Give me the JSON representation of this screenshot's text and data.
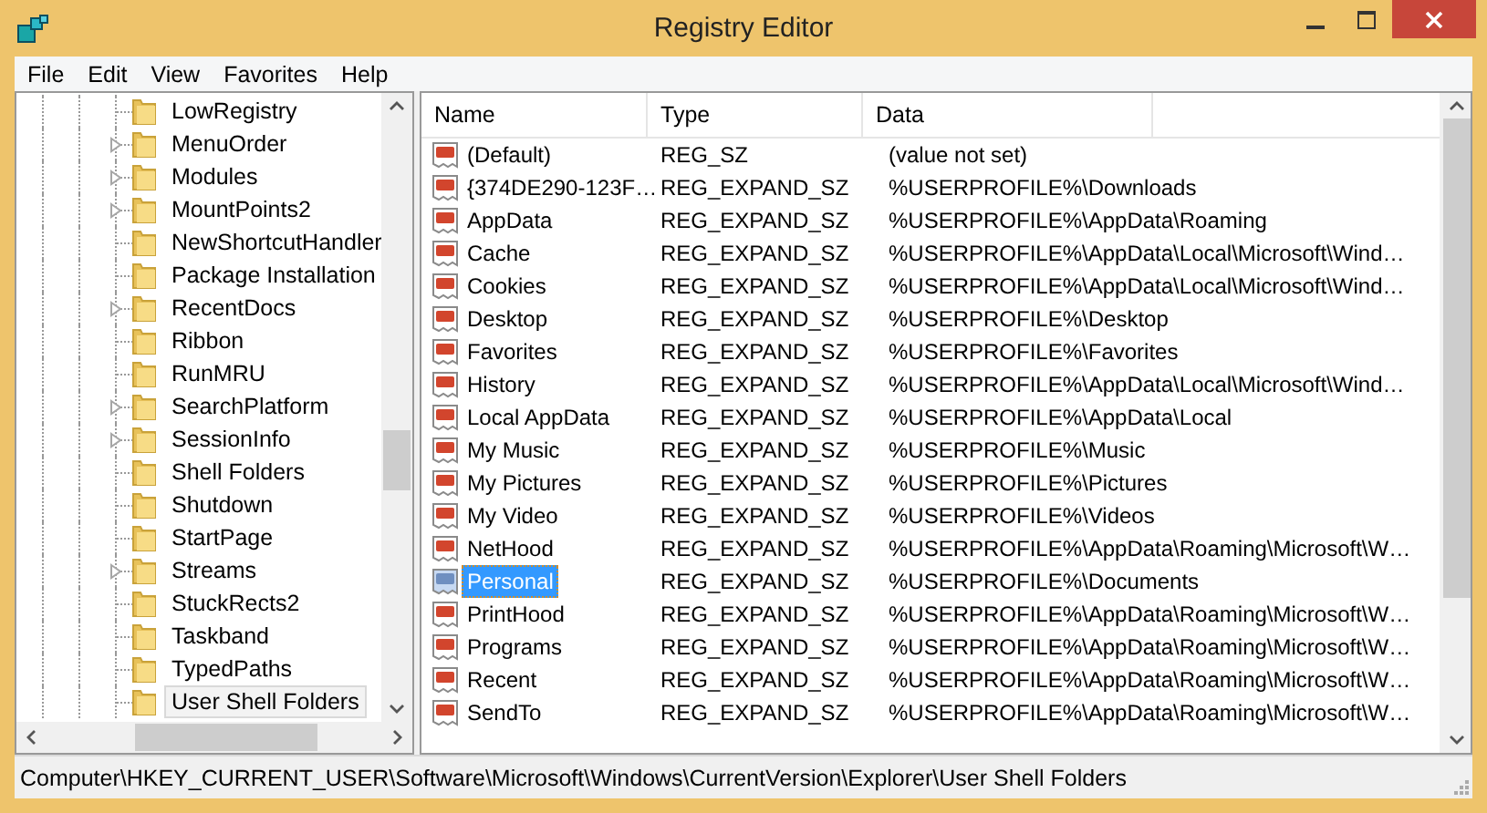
{
  "window": {
    "title": "Registry Editor"
  },
  "menu": [
    "File",
    "Edit",
    "View",
    "Favorites",
    "Help"
  ],
  "tree": {
    "items": [
      {
        "label": "LowRegistry",
        "expandable": false,
        "selected": false
      },
      {
        "label": "MenuOrder",
        "expandable": true,
        "selected": false
      },
      {
        "label": "Modules",
        "expandable": true,
        "selected": false
      },
      {
        "label": "MountPoints2",
        "expandable": true,
        "selected": false
      },
      {
        "label": "NewShortcutHandler",
        "expandable": false,
        "selected": false
      },
      {
        "label": "Package Installation",
        "expandable": false,
        "selected": false
      },
      {
        "label": "RecentDocs",
        "expandable": true,
        "selected": false
      },
      {
        "label": "Ribbon",
        "expandable": false,
        "selected": false
      },
      {
        "label": "RunMRU",
        "expandable": false,
        "selected": false
      },
      {
        "label": "SearchPlatform",
        "expandable": true,
        "selected": false
      },
      {
        "label": "SessionInfo",
        "expandable": true,
        "selected": false
      },
      {
        "label": "Shell Folders",
        "expandable": false,
        "selected": false
      },
      {
        "label": "Shutdown",
        "expandable": false,
        "selected": false
      },
      {
        "label": "StartPage",
        "expandable": false,
        "selected": false
      },
      {
        "label": "Streams",
        "expandable": true,
        "selected": false
      },
      {
        "label": "StuckRects2",
        "expandable": false,
        "selected": false
      },
      {
        "label": "Taskband",
        "expandable": false,
        "selected": false
      },
      {
        "label": "TypedPaths",
        "expandable": false,
        "selected": false
      },
      {
        "label": "User Shell Folders",
        "expandable": false,
        "selected": true
      }
    ]
  },
  "table": {
    "columns": [
      "Name",
      "Type",
      "Data"
    ],
    "rows": [
      {
        "name": "(Default)",
        "type": "REG_SZ",
        "data": "(value not set)",
        "selected": false
      },
      {
        "name": "{374DE290-123F…",
        "type": "REG_EXPAND_SZ",
        "data": "%USERPROFILE%\\Downloads",
        "selected": false
      },
      {
        "name": "AppData",
        "type": "REG_EXPAND_SZ",
        "data": "%USERPROFILE%\\AppData\\Roaming",
        "selected": false
      },
      {
        "name": "Cache",
        "type": "REG_EXPAND_SZ",
        "data": "%USERPROFILE%\\AppData\\Local\\Microsoft\\Wind…",
        "selected": false
      },
      {
        "name": "Cookies",
        "type": "REG_EXPAND_SZ",
        "data": "%USERPROFILE%\\AppData\\Local\\Microsoft\\Wind…",
        "selected": false
      },
      {
        "name": "Desktop",
        "type": "REG_EXPAND_SZ",
        "data": "%USERPROFILE%\\Desktop",
        "selected": false
      },
      {
        "name": "Favorites",
        "type": "REG_EXPAND_SZ",
        "data": "%USERPROFILE%\\Favorites",
        "selected": false
      },
      {
        "name": "History",
        "type": "REG_EXPAND_SZ",
        "data": "%USERPROFILE%\\AppData\\Local\\Microsoft\\Wind…",
        "selected": false
      },
      {
        "name": "Local AppData",
        "type": "REG_EXPAND_SZ",
        "data": "%USERPROFILE%\\AppData\\Local",
        "selected": false
      },
      {
        "name": "My Music",
        "type": "REG_EXPAND_SZ",
        "data": "%USERPROFILE%\\Music",
        "selected": false
      },
      {
        "name": "My Pictures",
        "type": "REG_EXPAND_SZ",
        "data": "%USERPROFILE%\\Pictures",
        "selected": false
      },
      {
        "name": "My Video",
        "type": "REG_EXPAND_SZ",
        "data": "%USERPROFILE%\\Videos",
        "selected": false
      },
      {
        "name": "NetHood",
        "type": "REG_EXPAND_SZ",
        "data": "%USERPROFILE%\\AppData\\Roaming\\Microsoft\\W…",
        "selected": false
      },
      {
        "name": "Personal",
        "type": "REG_EXPAND_SZ",
        "data": "%USERPROFILE%\\Documents",
        "selected": true
      },
      {
        "name": "PrintHood",
        "type": "REG_EXPAND_SZ",
        "data": "%USERPROFILE%\\AppData\\Roaming\\Microsoft\\W…",
        "selected": false
      },
      {
        "name": "Programs",
        "type": "REG_EXPAND_SZ",
        "data": "%USERPROFILE%\\AppData\\Roaming\\Microsoft\\W…",
        "selected": false
      },
      {
        "name": "Recent",
        "type": "REG_EXPAND_SZ",
        "data": "%USERPROFILE%\\AppData\\Roaming\\Microsoft\\W…",
        "selected": false
      },
      {
        "name": "SendTo",
        "type": "REG_EXPAND_SZ",
        "data": "%USERPROFILE%\\AppData\\Roaming\\Microsoft\\W…",
        "selected": false
      }
    ]
  },
  "status_bar": "Computer\\HKEY_CURRENT_USER\\Software\\Microsoft\\Windows\\CurrentVersion\\Explorer\\User Shell Folders"
}
